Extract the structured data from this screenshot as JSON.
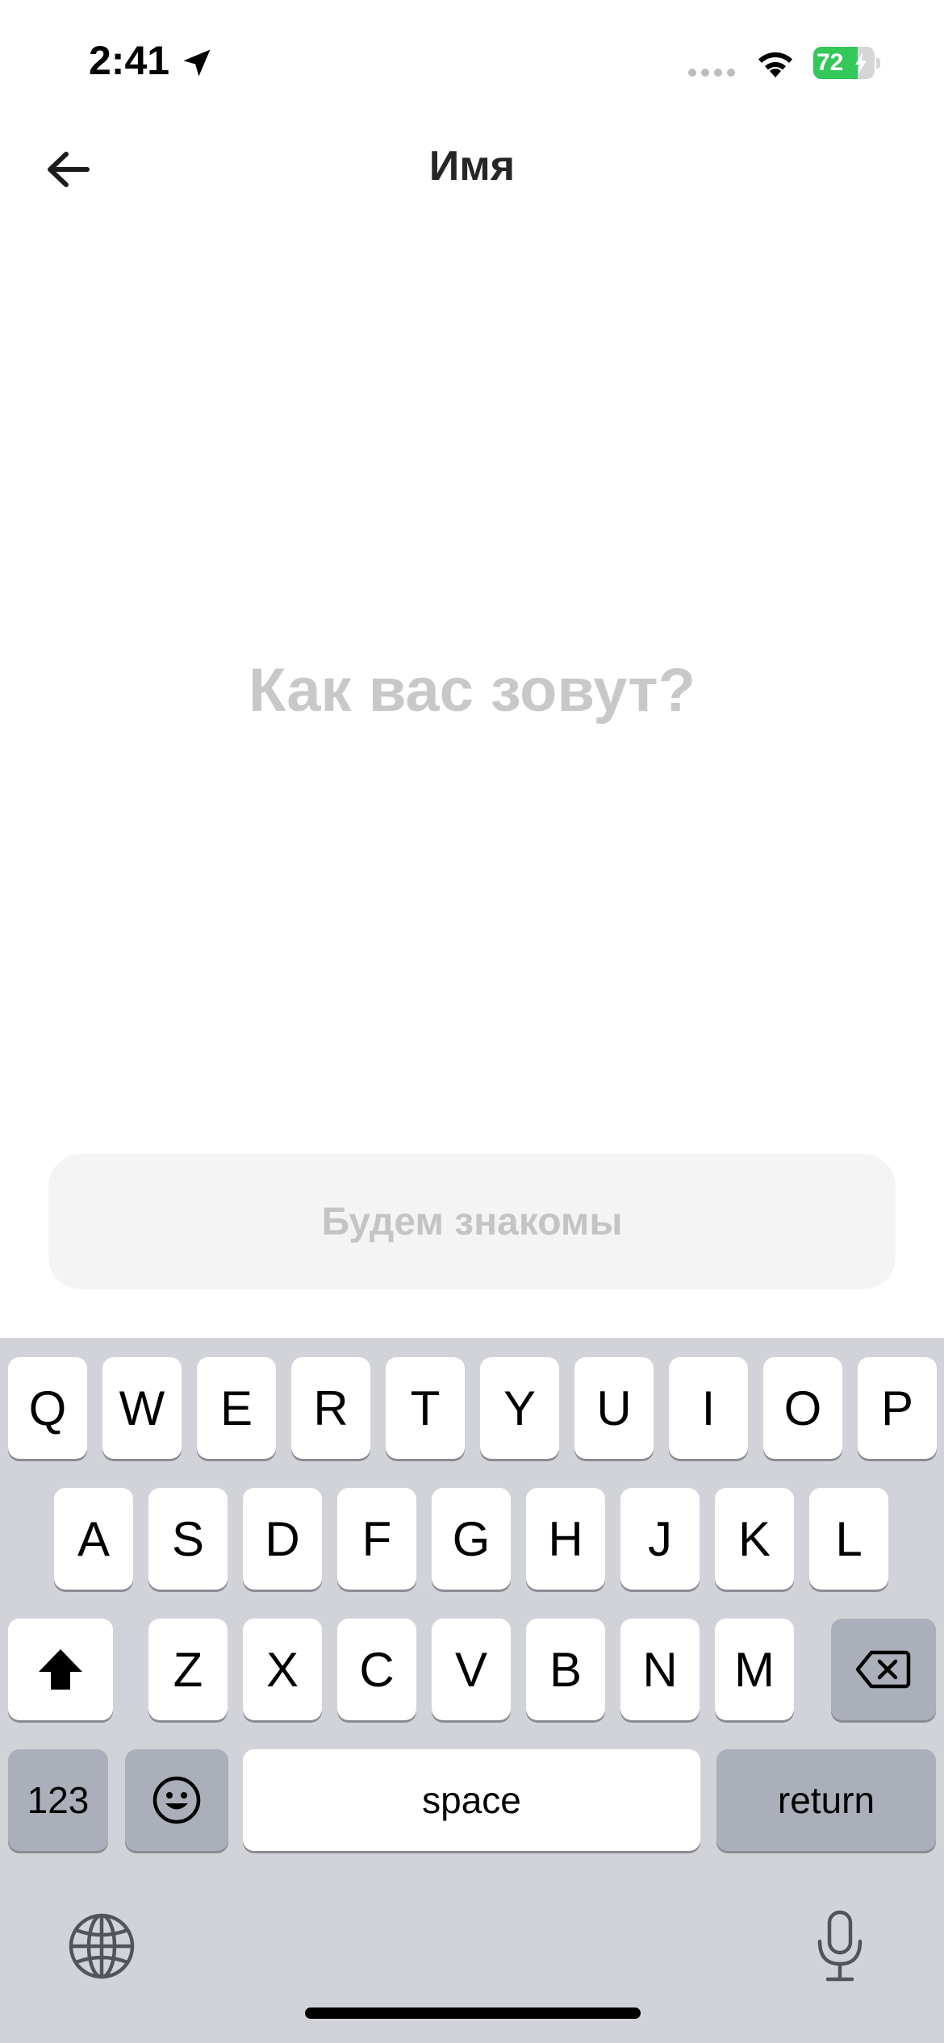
{
  "status_bar": {
    "time": "2:41",
    "battery_percent": "72",
    "battery_level": 0.72,
    "battery_color": "#34c759",
    "icons": [
      "location-arrow-icon",
      "cellular-signal-icon",
      "wifi-icon",
      "battery-charging-icon"
    ]
  },
  "nav": {
    "title": "Имя",
    "back_icon": "arrow-left-icon"
  },
  "name_field": {
    "placeholder": "Как вас зовут?",
    "value": ""
  },
  "submit_button": {
    "label": "Будем знакомы"
  },
  "keyboard": {
    "row1": [
      "Q",
      "W",
      "E",
      "R",
      "T",
      "Y",
      "U",
      "I",
      "O",
      "P"
    ],
    "row2": [
      "A",
      "S",
      "D",
      "F",
      "G",
      "H",
      "J",
      "K",
      "L"
    ],
    "row3": [
      "Z",
      "X",
      "C",
      "V",
      "B",
      "N",
      "M"
    ],
    "shift_icon": "shift-icon",
    "delete_icon": "backspace-icon",
    "numbers_label": "123",
    "emoji_icon": "emoji-icon",
    "space_label": "space",
    "return_label": "return",
    "globe_icon": "globe-icon",
    "mic_icon": "microphone-icon"
  }
}
